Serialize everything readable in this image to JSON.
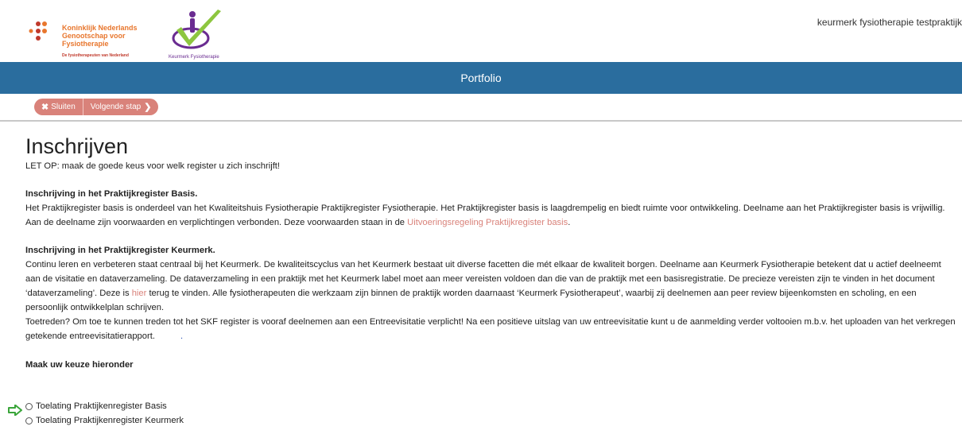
{
  "header": {
    "kngf": {
      "line1": "Koninklijk Nederlands",
      "line2": "Genootschap voor Fysiotherapie",
      "tagline": "De fysiotherapeuten van Nederland"
    },
    "keurmerk_label": "Keurmerk Fysiotherapie",
    "user": "keurmerk fysiotherapie testpraktijk"
  },
  "titlebar": {
    "title": "Portfolio"
  },
  "toolbar": {
    "close_label": "Sluiten",
    "close_icon": "✖",
    "next_label": "Volgende stap",
    "next_icon": "❯"
  },
  "page": {
    "title": "Inschrijven",
    "intro": "LET OP: maak de goede keus voor welk register u zich inschrijft!",
    "basis": {
      "heading": "Inschrijving in het Praktijkregister Basis.",
      "text1": "Het Praktijkregister basis is onderdeel van het Kwaliteitshuis Fysiotherapie Praktijkregister Fysiotherapie. Het Praktijkregister basis is laagdrempelig en biedt ruimte voor ontwikkeling. Deelname aan het Praktijkregister basis is vrijwillig. Aan de deelname zijn voorwaarden en verplichtingen verbonden. Deze voorwaarden staan in de ",
      "link": "Uitvoeringsregeling Praktijkregister basis",
      "text2": "."
    },
    "keurmerk": {
      "heading": "Inschrijving in het Praktijkregister Keurmerk.",
      "text1": "Continu leren en verbeteren staat centraal bij het Keurmerk. De kwaliteitscyclus van het Keurmerk bestaat uit diverse facetten die mét elkaar de kwaliteit borgen. Deelname aan Keurmerk Fysiotherapie betekent dat u actief deelneemt aan de visitatie en dataverzameling. De dataverzameling in een praktijk met het Keurmerk label moet aan meer vereisten voldoen dan die van de praktijk met een basisregistratie. De precieze vereisten zijn te vinden in het document ‘dataverzameling’. Deze is ",
      "link": "hier",
      "text2": " terug te vinden. Alle fysiotherapeuten die werkzaam zijn binnen de praktijk worden daarnaast ‘Keurmerk Fysiotherapeut’, waarbij zij deelnemen aan peer review bijeenkomsten en scholing, en een persoonlijk ontwikkelplan schrijven.",
      "text3": "Toetreden? Om toe te kunnen treden tot het SKF register is vooraf deelnemen aan een Entreevisitatie verplicht! Na een positieve uitslag van uw entreevisitatie kunt u de aanmelding verder voltooien m.b.v. het uploaden van het verkregen getekende entreevisitatierapport.",
      "dot": "."
    },
    "choice_heading": "Maak uw keuze hieronder",
    "options": [
      {
        "label": "Toelating Praktijkenregister Basis"
      },
      {
        "label": "Toelating Praktijkenregister Keurmerk"
      }
    ]
  },
  "colors": {
    "accent": "#2a6d9e",
    "button": "#d9827a",
    "link": "#d9827a",
    "arrow": "#3aa53a"
  }
}
